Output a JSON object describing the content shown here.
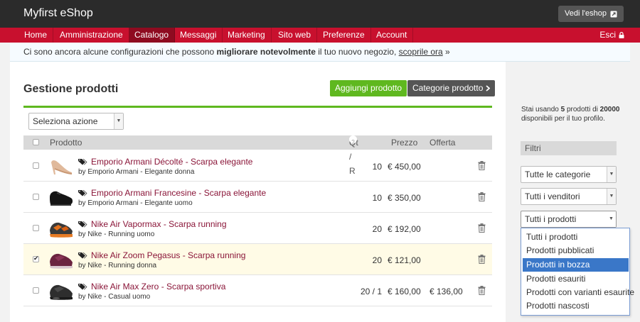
{
  "header": {
    "brand": "Myfirst eShop",
    "store_button": "Vedi l'eshop",
    "store_icon": "external-link-icon"
  },
  "nav": {
    "items": [
      "Home",
      "Amministrazione",
      "Catalogo",
      "Messaggi",
      "Marketing",
      "Sito web",
      "Preferenze",
      "Account"
    ],
    "active": "Catalogo",
    "exit_label": "Esci",
    "exit_icon": "lock-icon"
  },
  "notice": {
    "text_before": "Ci sono ancora alcune configurazioni che possono",
    "bold": "migliorare notevolmente",
    "text_middle": "il tuo nuovo negozio,",
    "link": "scoprile ora",
    "suffix": "»"
  },
  "main": {
    "title": "Gestione prodotti",
    "add_button": "Aggiungi prodotto",
    "categories_button": "Categorie prodotto",
    "action_select": "Seleziona azione"
  },
  "table": {
    "headers": {
      "product": "Prodotto",
      "qty": "Qt / R",
      "price": "Prezzo",
      "offer": "Offerta"
    },
    "rows": [
      {
        "name": "Emporio Armani Décolté - Scarpa elegante",
        "meta": "by Emporio Armani - Elegante donna",
        "qty": "10",
        "price": "€ 450,00",
        "offer": "",
        "checked": false,
        "thumb": "heel"
      },
      {
        "name": "Emporio Armani Francesine - Scarpa elegante",
        "meta": "by Emporio Armani - Elegante uomo",
        "qty": "10",
        "price": "€ 350,00",
        "offer": "",
        "checked": false,
        "thumb": "oxford"
      },
      {
        "name": "Nike Air Vapormax - Scarpa running",
        "meta": "by Nike - Running uomo",
        "qty": "20",
        "price": "€ 192,00",
        "offer": "",
        "checked": false,
        "thumb": "vapormax"
      },
      {
        "name": "Nike Air Zoom Pegasus - Scarpa running",
        "meta": "by Nike - Running donna",
        "qty": "20",
        "price": "€ 121,00",
        "offer": "",
        "checked": true,
        "thumb": "pegasus"
      },
      {
        "name": "Nike Air Max Zero - Scarpa sportiva",
        "meta": "by Nike - Casual uomo",
        "qty": "20 / 1",
        "price": "€ 160,00",
        "offer": "€ 136,00",
        "checked": false,
        "thumb": "airmax"
      }
    ]
  },
  "sidebar": {
    "usage_prefix": "Stai usando",
    "usage_used": "5",
    "usage_mid": "prodotti di",
    "usage_total": "20000",
    "usage_suffix": "disponibili per il tuo profilo.",
    "filters_title": "Filtri",
    "category_select": "Tutte le categorie",
    "vendor_select": "Tutti i venditori",
    "product_select": "Tutti i prodotti",
    "product_options": [
      "Tutti i prodotti",
      "Prodotti pubblicati",
      "Prodotti in bozza",
      "Prodotti esauriti",
      "Prodotti con varianti esaurite",
      "Prodotti nascosti"
    ],
    "highlighted_option": "Prodotti in bozza"
  },
  "colors": {
    "nav_red": "#c8102e",
    "nav_active": "#8e0b20",
    "green": "#5fb81f",
    "product_link": "#8a1538",
    "highlight_blue": "#3a77c8"
  }
}
